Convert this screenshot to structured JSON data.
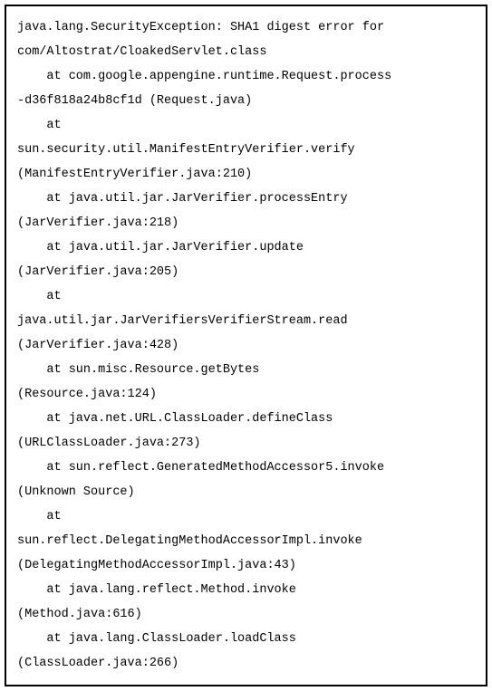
{
  "stacktrace": {
    "exception_line1": "java.lang.SecurityException: SHA1 digest error for",
    "exception_line2": "com/Altostrat/CloakedServlet.class",
    "frame0_line1": "    at com.google.appengine.runtime.Request.process",
    "frame0_line2": "-d36f818a24b8cf1d (Request.java)",
    "frame1_line1": "    at",
    "frame1_line2": "sun.security.util.ManifestEntryVerifier.verify",
    "frame1_line3": "(ManifestEntryVerifier.java:210)",
    "frame2_line1": "    at java.util.jar.JarVerifier.processEntry",
    "frame2_line2": "(JarVerifier.java:218)",
    "frame3_line1": "    at java.util.jar.JarVerifier.update",
    "frame3_line2": "(JarVerifier.java:205)",
    "frame4_line1": "    at",
    "frame4_line2": "java.util.jar.JarVerifiersVerifierStream.read",
    "frame4_line3": "(JarVerifier.java:428)",
    "frame5_line1": "    at sun.misc.Resource.getBytes",
    "frame5_line2": "(Resource.java:124)",
    "frame6_line1": "    at java.net.URL.ClassLoader.defineClass",
    "frame6_line2": "(URLClassLoader.java:273)",
    "frame7_line1": "    at sun.reflect.GeneratedMethodAccessor5.invoke",
    "frame7_line2": "(Unknown Source)",
    "frame8_line1": "    at",
    "frame8_line2": "sun.reflect.DelegatingMethodAccessorImpl.invoke",
    "frame8_line3": "(DelegatingMethodAccessorImpl.java:43)",
    "frame9_line1": "    at java.lang.reflect.Method.invoke",
    "frame9_line2": "(Method.java:616)",
    "frame10_line1": "    at java.lang.ClassLoader.loadClass",
    "frame10_line2": "(ClassLoader.java:266)"
  }
}
